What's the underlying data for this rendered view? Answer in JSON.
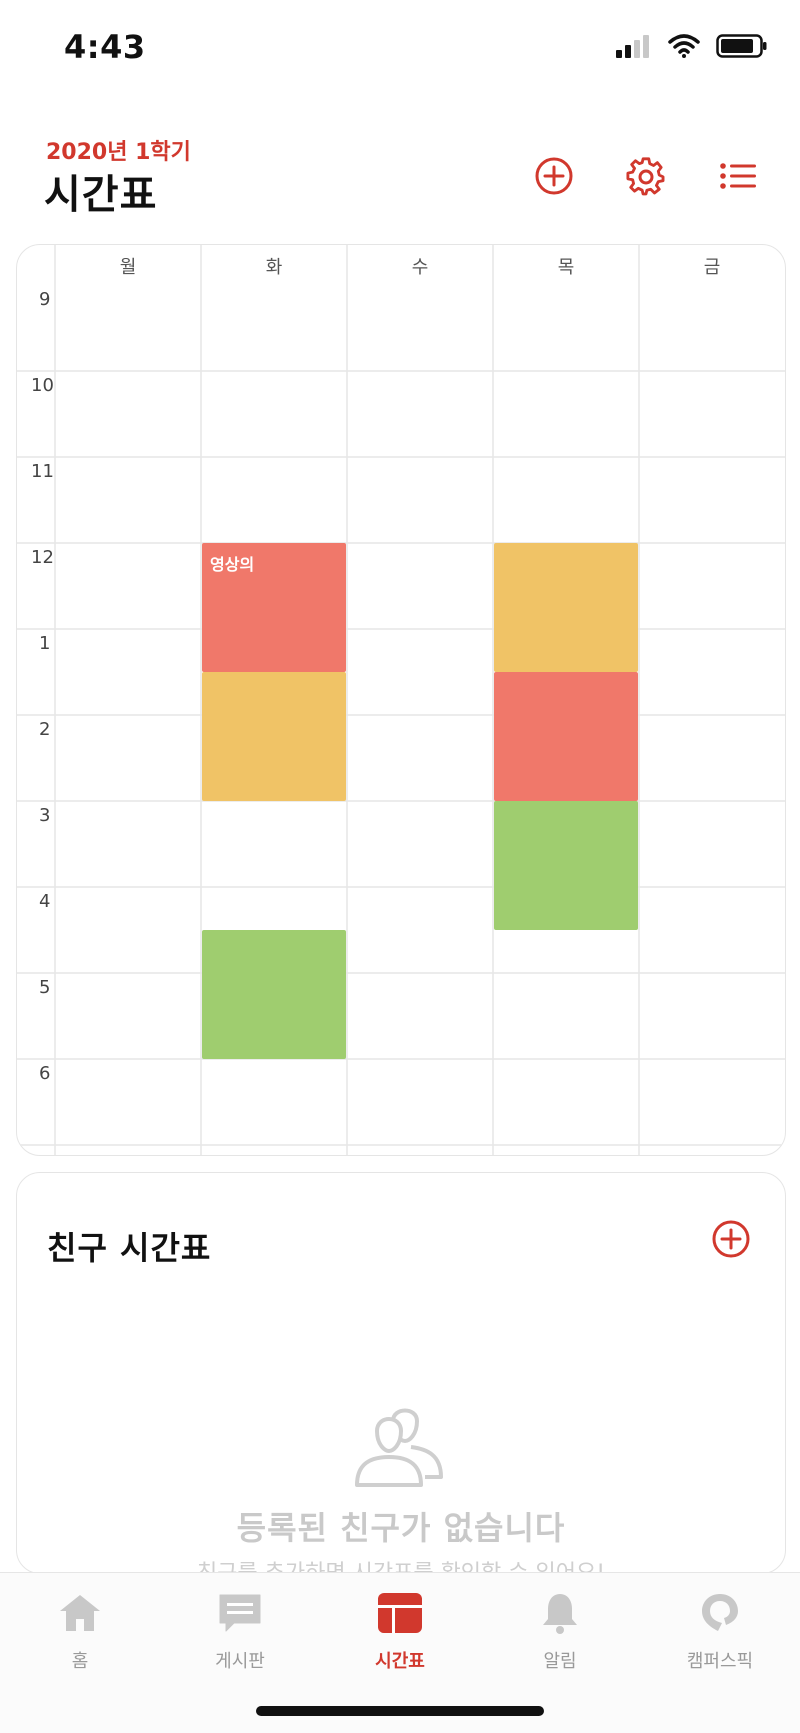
{
  "status_bar": {
    "time": "4:43"
  },
  "header": {
    "semester": "2020년 1학기",
    "title": "시간표"
  },
  "timetable": {
    "days": [
      "월",
      "화",
      "수",
      "목",
      "금"
    ],
    "hours": [
      "9",
      "10",
      "11",
      "12",
      "1",
      "2",
      "3",
      "4",
      "5",
      "6"
    ],
    "events": [
      {
        "day_index": 1,
        "start_hour": 12.0,
        "end_hour": 13.5,
        "color": "#f0786a",
        "title": "영상의"
      },
      {
        "day_index": 1,
        "start_hour": 13.5,
        "end_hour": 15.0,
        "color": "#f0c366",
        "title": ""
      },
      {
        "day_index": 1,
        "start_hour": 16.5,
        "end_hour": 18.0,
        "color": "#9fcd6f",
        "title": ""
      },
      {
        "day_index": 3,
        "start_hour": 12.0,
        "end_hour": 13.5,
        "color": "#f0c366",
        "title": ""
      },
      {
        "day_index": 3,
        "start_hour": 13.5,
        "end_hour": 15.0,
        "color": "#f0786a",
        "title": ""
      },
      {
        "day_index": 3,
        "start_hour": 15.0,
        "end_hour": 16.5,
        "color": "#9fcd6f",
        "title": ""
      }
    ]
  },
  "friends": {
    "title": "친구 시간표",
    "empty_title": "등록된 친구가 없습니다",
    "empty_subtitle": "친구를 추가하면 시간표를 확인할 수 있어요!"
  },
  "tabbar": {
    "items": [
      {
        "label": "홈",
        "icon": "home-icon",
        "active": false
      },
      {
        "label": "게시판",
        "icon": "board-icon",
        "active": false
      },
      {
        "label": "시간표",
        "icon": "timetable-icon",
        "active": true
      },
      {
        "label": "알림",
        "icon": "bell-icon",
        "active": false
      },
      {
        "label": "캠퍼스픽",
        "icon": "campuspick-icon",
        "active": false
      }
    ]
  },
  "colors": {
    "accent": "#d1382d",
    "event_red": "#f0786a",
    "event_yellow": "#f0c366",
    "event_green": "#9fcd6f"
  }
}
